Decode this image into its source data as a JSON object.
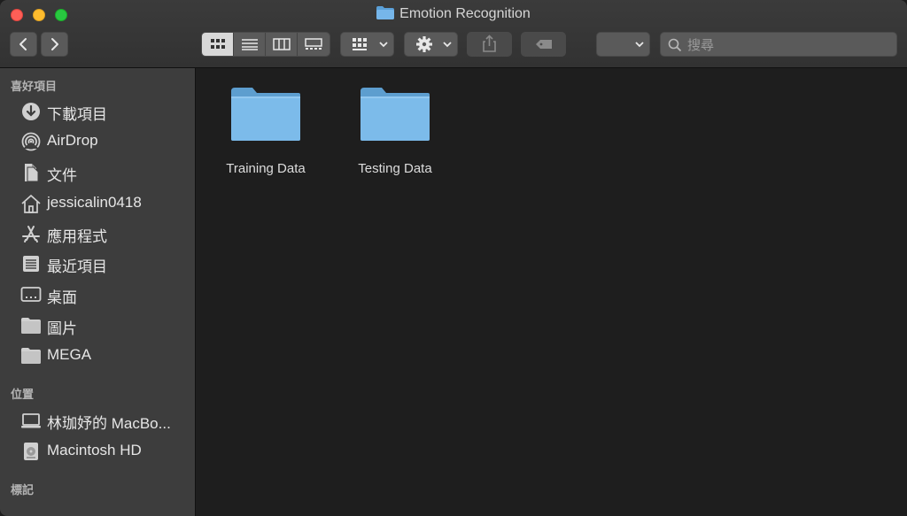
{
  "window": {
    "title": "Emotion Recognition"
  },
  "search": {
    "placeholder": "搜尋"
  },
  "sidebar": {
    "favorites_title": "喜好項目",
    "favorites": [
      {
        "label": "下載項目",
        "icon": "download-icon"
      },
      {
        "label": "AirDrop",
        "icon": "airdrop-icon"
      },
      {
        "label": "文件",
        "icon": "documents-icon"
      },
      {
        "label": "jessicalin0418",
        "icon": "home-icon"
      },
      {
        "label": "應用程式",
        "icon": "applications-icon"
      },
      {
        "label": "最近項目",
        "icon": "recents-icon"
      },
      {
        "label": "桌面",
        "icon": "desktop-icon"
      },
      {
        "label": "圖片",
        "icon": "folder-icon"
      },
      {
        "label": "MEGA",
        "icon": "folder-icon"
      }
    ],
    "locations_title": "位置",
    "locations": [
      {
        "label": "林珈妤的 MacBo...",
        "icon": "laptop-icon"
      },
      {
        "label": "Macintosh HD",
        "icon": "disk-icon"
      }
    ],
    "tags_title": "標記"
  },
  "files": [
    {
      "name": "Training Data",
      "icon": "folder-icon"
    },
    {
      "name": "Testing Data",
      "icon": "folder-icon"
    }
  ],
  "colors": {
    "folder_top": "#5d9ecf",
    "folder_body": "#7cbbea",
    "sidebar_bg": "#3d3d3d"
  }
}
